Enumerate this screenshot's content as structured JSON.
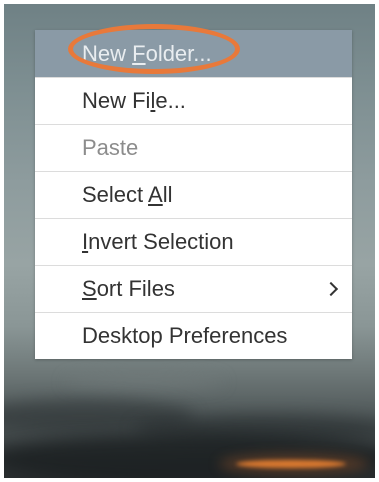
{
  "context_menu": {
    "items": [
      {
        "before": "New ",
        "mnemonic": "F",
        "after": "older...",
        "state": "hovered"
      },
      {
        "before": "New Fi",
        "mnemonic": "l",
        "after": "e...",
        "state": "normal"
      },
      {
        "before": "Paste",
        "mnemonic": "",
        "after": "",
        "state": "disabled"
      },
      {
        "before": "Select ",
        "mnemonic": "A",
        "after": "ll",
        "state": "normal"
      },
      {
        "before": "",
        "mnemonic": "I",
        "after": "nvert Selection",
        "state": "normal"
      },
      {
        "before": "",
        "mnemonic": "S",
        "after": "ort Files",
        "state": "normal",
        "submenu": true
      },
      {
        "before": "Desktop Preferences",
        "mnemonic": "",
        "after": "",
        "state": "normal"
      }
    ]
  },
  "annotation": {
    "shape": "ellipse",
    "color": "#e8793a",
    "target": "New Folder..."
  },
  "colors": {
    "menu_background": "#ffffff",
    "hover_background": "#8a9aa6",
    "text": "#333333",
    "disabled_text": "#8c8c8c"
  }
}
